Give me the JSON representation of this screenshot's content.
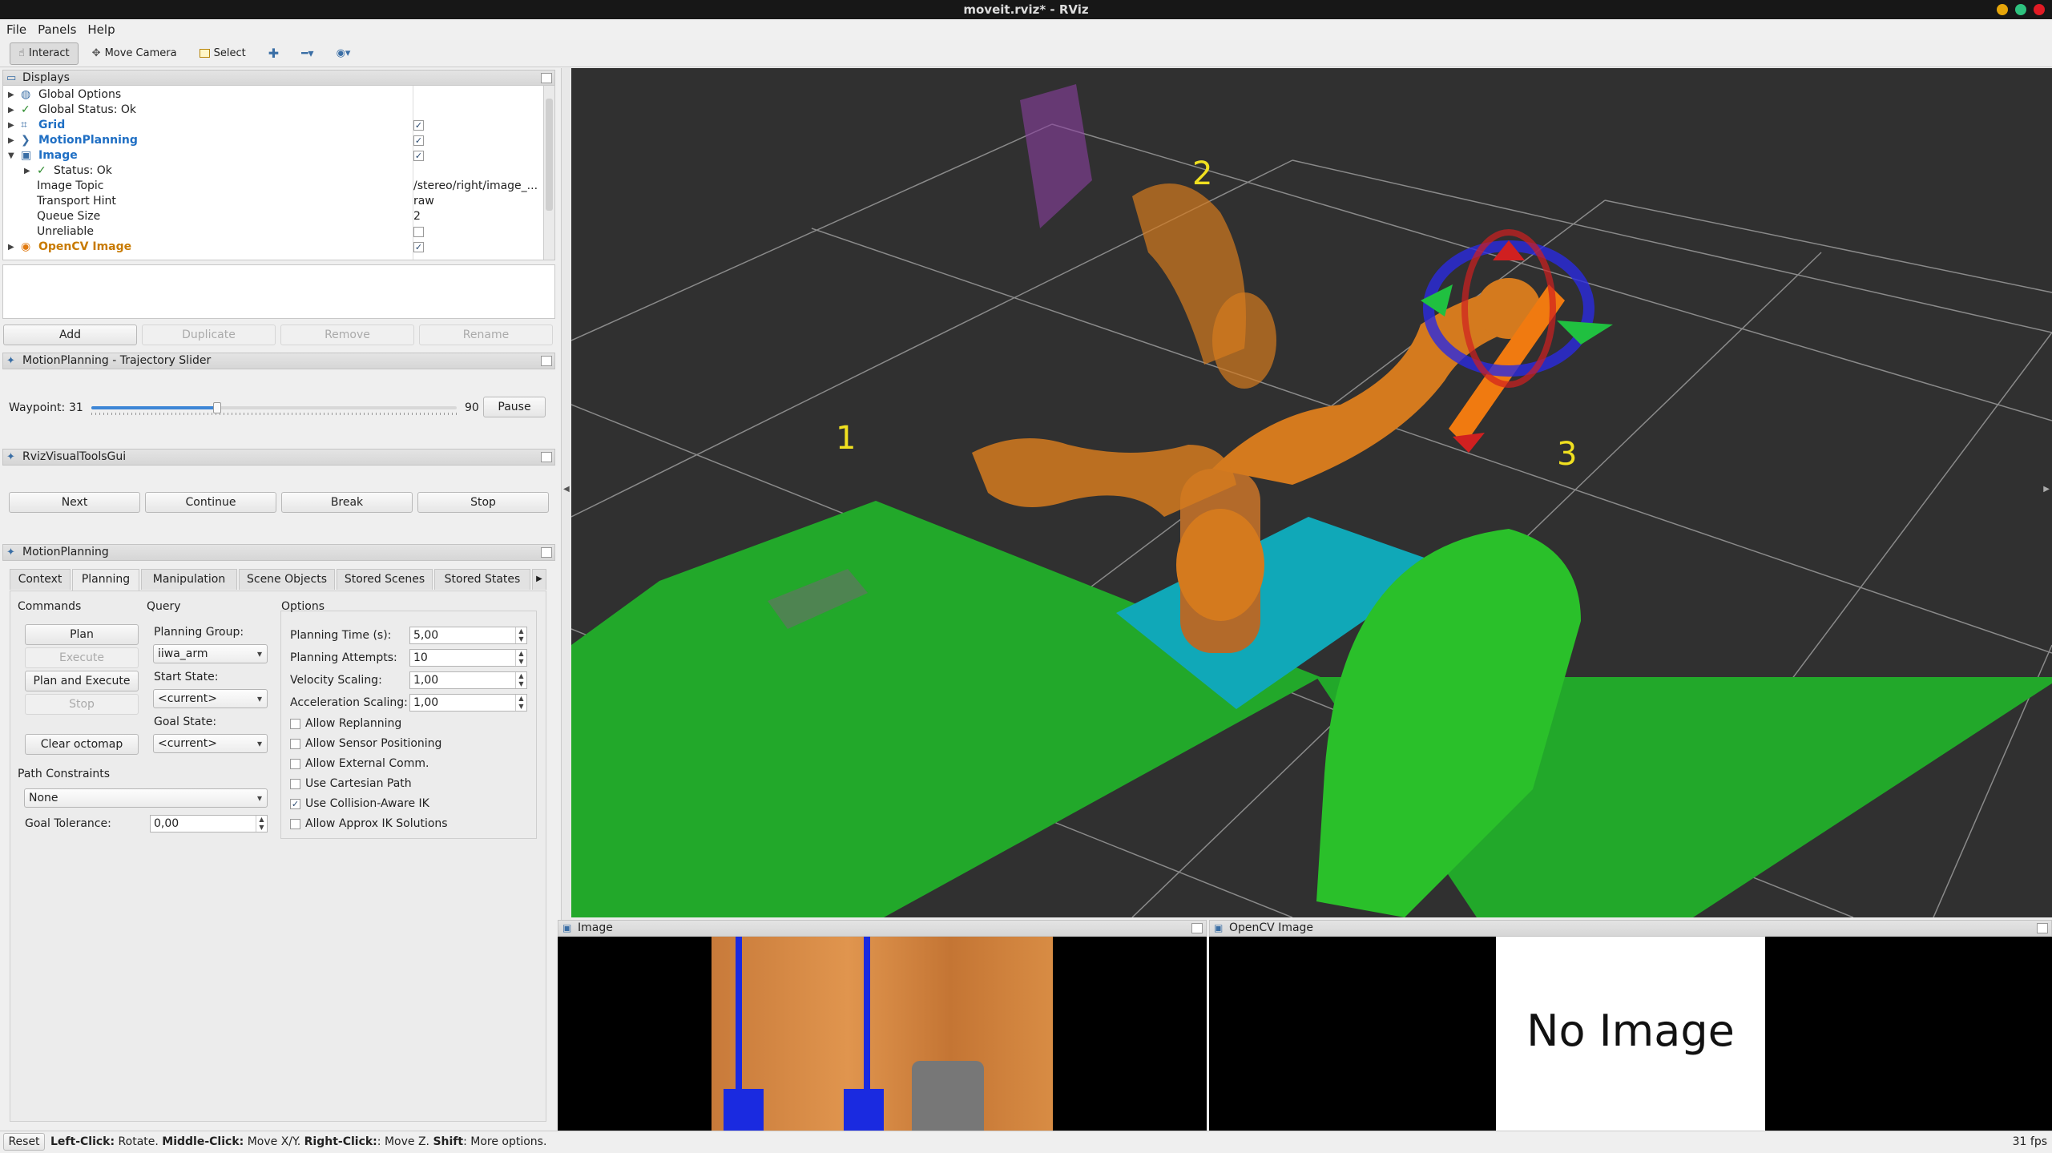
{
  "window": {
    "title": "moveit.rviz* - RViz"
  },
  "menus": [
    "File",
    "Panels",
    "Help"
  ],
  "toolbar": {
    "interact": "Interact",
    "move_camera": "Move Camera",
    "select": "Select"
  },
  "displays_panel": {
    "title": "Displays",
    "rows": [
      {
        "label": "Global Options",
        "value": ""
      },
      {
        "label": "Global Status: Ok",
        "value": ""
      },
      {
        "label": "Grid",
        "value": "✓"
      },
      {
        "label": "MotionPlanning",
        "value": "✓"
      },
      {
        "label": "Image",
        "value": "✓"
      },
      {
        "label": "Status: Ok",
        "value": ""
      },
      {
        "label": "Image Topic",
        "value": "/stereo/right/image_..."
      },
      {
        "label": "Transport Hint",
        "value": "raw"
      },
      {
        "label": "Queue Size",
        "value": "2"
      },
      {
        "label": "Unreliable",
        "value": ""
      },
      {
        "label": "OpenCV Image",
        "value": "✓"
      }
    ],
    "buttons": {
      "add": "Add",
      "duplicate": "Duplicate",
      "remove": "Remove",
      "rename": "Rename"
    }
  },
  "trajectory_panel": {
    "title": "MotionPlanning - Trajectory Slider",
    "waypoint_label": "Waypoint:",
    "waypoint_value": "31",
    "waypoint_max": "90",
    "waypoint_fraction": 0.344,
    "pause": "Pause"
  },
  "visual_tools_panel": {
    "title": "RvizVisualToolsGui",
    "buttons": [
      "Next",
      "Continue",
      "Break",
      "Stop"
    ]
  },
  "motion_planning": {
    "title": "MotionPlanning",
    "tabs": [
      "Context",
      "Planning",
      "Manipulation",
      "Scene Objects",
      "Stored Scenes",
      "Stored States"
    ],
    "commands_label": "Commands",
    "commands": {
      "plan": "Plan",
      "execute": "Execute",
      "plan_execute": "Plan and Execute",
      "stop": "Stop",
      "clear_octomap": "Clear octomap"
    },
    "query_label": "Query",
    "planning_group_label": "Planning Group:",
    "planning_group": "iiwa_arm",
    "start_state_label": "Start State:",
    "start_state": "<current>",
    "goal_state_label": "Goal State:",
    "goal_state": "<current>",
    "options_label": "Options",
    "options": [
      {
        "label": "Planning Time (s):",
        "value": "5,00"
      },
      {
        "label": "Planning Attempts:",
        "value": "10"
      },
      {
        "label": "Velocity Scaling:",
        "value": "1,00"
      },
      {
        "label": "Acceleration Scaling:",
        "value": "1,00"
      }
    ],
    "checkboxes": [
      {
        "label": "Allow Replanning",
        "checked": ""
      },
      {
        "label": "Allow Sensor Positioning",
        "checked": ""
      },
      {
        "label": "Allow External Comm.",
        "checked": ""
      },
      {
        "label": "Use Cartesian Path",
        "checked": ""
      },
      {
        "label": "Use Collision-Aware IK",
        "checked": "✓"
      },
      {
        "label": "Allow Approx IK Solutions",
        "checked": ""
      }
    ],
    "path_constraints_label": "Path Constraints",
    "path_constraints": "None",
    "goal_tolerance_label": "Goal Tolerance:",
    "goal_tolerance": "0,00"
  },
  "viewport": {
    "labels": [
      "1",
      "2",
      "3"
    ]
  },
  "image_panel": {
    "title": "Image"
  },
  "opencv_panel": {
    "title": "OpenCV Image",
    "no_image": "No Image"
  },
  "status": {
    "reset": "Reset",
    "left_click": "Left-Click:",
    "left_desc": " Rotate. ",
    "middle_click": "Middle-Click:",
    "middle_desc": " Move X/Y. ",
    "right_click": "Right-Click:",
    "right_desc": ": Move Z. ",
    "shift": "Shift",
    "shift_desc": ": More options.",
    "fps": "31 fps"
  }
}
